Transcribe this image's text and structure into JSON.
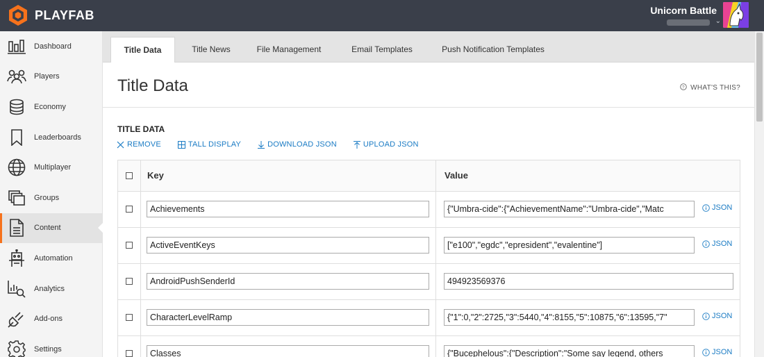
{
  "brand": {
    "name": "PLAYFAB",
    "accent": "#f6721c"
  },
  "title": {
    "name": "Unicorn Battle"
  },
  "sidebar": {
    "items": [
      {
        "label": "Dashboard",
        "icon": "dashboard-icon"
      },
      {
        "label": "Players",
        "icon": "players-icon"
      },
      {
        "label": "Economy",
        "icon": "economy-icon"
      },
      {
        "label": "Leaderboards",
        "icon": "leaderboards-icon"
      },
      {
        "label": "Multiplayer",
        "icon": "multiplayer-icon"
      },
      {
        "label": "Groups",
        "icon": "groups-icon"
      },
      {
        "label": "Content",
        "icon": "content-icon",
        "active": true
      },
      {
        "label": "Automation",
        "icon": "automation-icon"
      },
      {
        "label": "Analytics",
        "icon": "analytics-icon"
      },
      {
        "label": "Add-ons",
        "icon": "addons-icon"
      },
      {
        "label": "Settings",
        "icon": "settings-icon"
      }
    ]
  },
  "tabs": [
    {
      "label": "Title Data",
      "active": true
    },
    {
      "label": "Title News"
    },
    {
      "label": "File Management"
    },
    {
      "label": "Email Templates"
    },
    {
      "label": "Push Notification Templates"
    }
  ],
  "page": {
    "title": "Title Data",
    "whats_this": "WHAT'S THIS?",
    "section_title": "TITLE DATA"
  },
  "actions": {
    "remove": "REMOVE",
    "tall_display": "TALL DISPLAY",
    "download_json": "DOWNLOAD JSON",
    "upload_json": "UPLOAD JSON"
  },
  "table": {
    "headers": {
      "key": "Key",
      "value": "Value"
    },
    "json_label": "JSON",
    "rows": [
      {
        "key": "Achievements",
        "value": "{\"Umbra-cide\":{\"AchievementName\":\"Umbra-cide\",\"Matc",
        "json": true
      },
      {
        "key": "ActiveEventKeys",
        "value": "[\"e100\",\"egdc\",\"epresident\",\"evalentine\"]",
        "json": true
      },
      {
        "key": "AndroidPushSenderId",
        "value": "494923569376",
        "json": false
      },
      {
        "key": "CharacterLevelRamp",
        "value": "{\"1\":0,\"2\":2725,\"3\":5440,\"4\":8155,\"5\":10875,\"6\":13595,\"7\"",
        "json": true
      },
      {
        "key": "Classes",
        "value": "{\"Bucephelous\":{\"Description\":\"Some say legend, others",
        "json": true
      }
    ]
  }
}
